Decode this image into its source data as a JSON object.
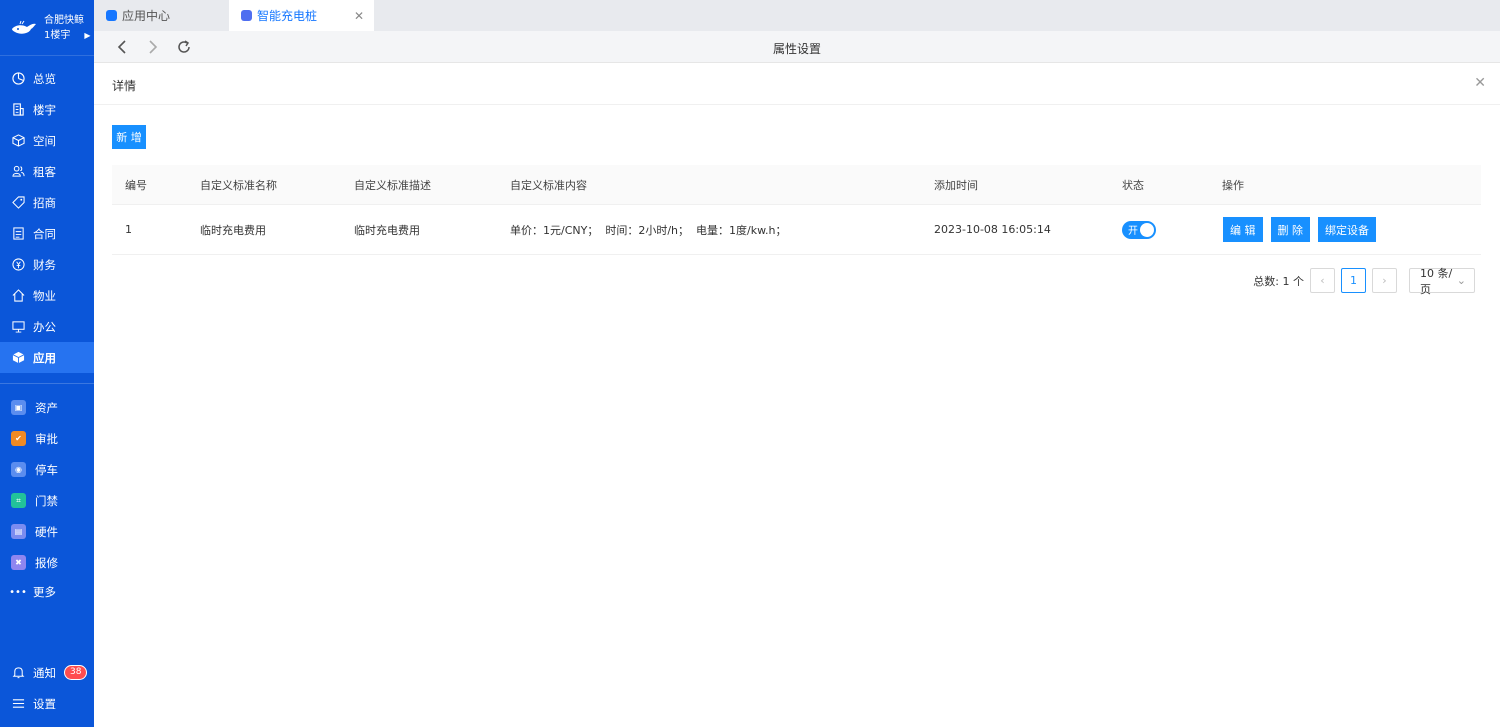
{
  "brand": {
    "name": "合肥快鲸",
    "building": "1楼宇"
  },
  "sidebar": {
    "items": [
      {
        "label": "总览",
        "icon": "dashboard-icon"
      },
      {
        "label": "楼宇",
        "icon": "building-icon"
      },
      {
        "label": "空间",
        "icon": "cube-icon"
      },
      {
        "label": "租客",
        "icon": "users-icon"
      },
      {
        "label": "招商",
        "icon": "tag-icon"
      },
      {
        "label": "合同",
        "icon": "document-icon"
      },
      {
        "label": "财务",
        "icon": "currency-icon"
      },
      {
        "label": "物业",
        "icon": "home-icon"
      },
      {
        "label": "办公",
        "icon": "monitor-icon"
      },
      {
        "label": "应用",
        "icon": "app-cube-icon",
        "active": true
      }
    ],
    "apps": [
      {
        "label": "资产",
        "icon": "asset-icon",
        "color": "#5b8def"
      },
      {
        "label": "审批",
        "icon": "approval-icon",
        "color": "#f08a24"
      },
      {
        "label": "停车",
        "icon": "parking-icon",
        "color": "#5b8def"
      },
      {
        "label": "门禁",
        "icon": "access-control-icon",
        "color": "#22c29a"
      },
      {
        "label": "硬件",
        "icon": "hardware-icon",
        "color": "#7b8cf0"
      },
      {
        "label": "报修",
        "icon": "repair-icon",
        "color": "#8f86f0"
      }
    ],
    "more": "更多",
    "notify": {
      "label": "通知",
      "count": "38"
    },
    "settings": "设置"
  },
  "tabs": [
    {
      "label": "应用中心",
      "icon": "app-center-icon"
    },
    {
      "label": "智能充电桩",
      "icon": "charging-pile-icon",
      "active": true
    }
  ],
  "toolbar": {
    "title": "属性设置"
  },
  "panel": {
    "title": "详情"
  },
  "add_button": "新 增",
  "table": {
    "columns": [
      "编号",
      "自定义标准名称",
      "自定义标准描述",
      "自定义标准内容",
      "添加时间",
      "状态",
      "操作"
    ],
    "rows": [
      {
        "id": "1",
        "name": "临时充电费用",
        "desc": "临时充电费用",
        "content": "单价：1元/CNY；  时间：2小时/h；  电量：1度/kw.h；",
        "time": "2023-10-08 16:05:14",
        "status": "开",
        "actions": [
          "编 辑",
          "删 除",
          "绑定设备"
        ]
      }
    ]
  },
  "pagination": {
    "total": "总数: 1 个",
    "current": "1",
    "page_size": "10 条/页"
  },
  "colors": {
    "sidebar": "#0b56d9",
    "primary": "#1890ff",
    "badge": "#ff4d4f"
  }
}
